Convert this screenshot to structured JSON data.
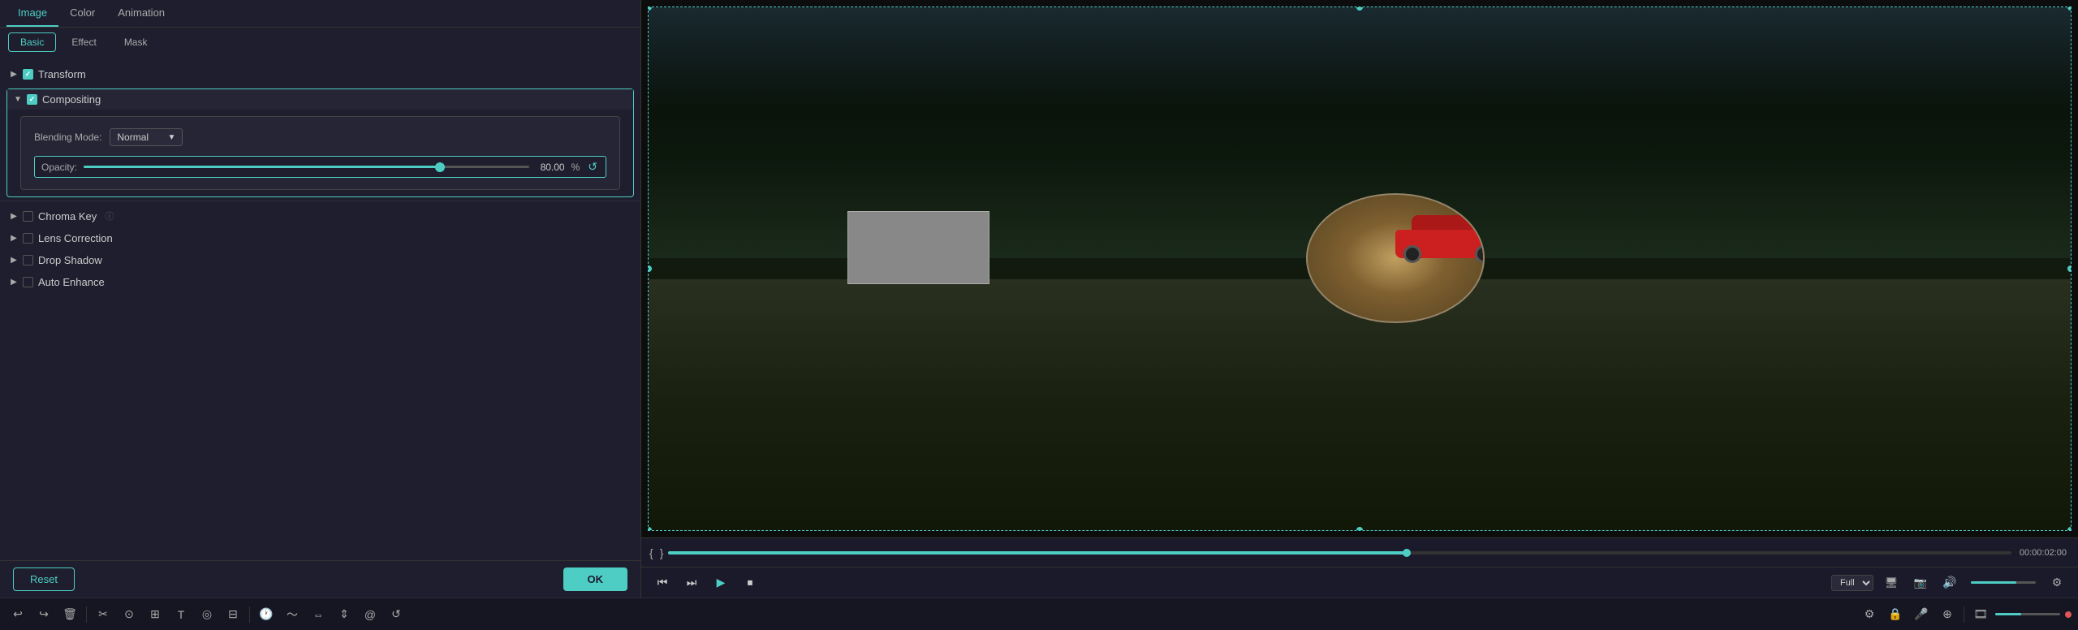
{
  "topTabs": [
    {
      "id": "image",
      "label": "Image",
      "active": true
    },
    {
      "id": "color",
      "label": "Color",
      "active": false
    },
    {
      "id": "animation",
      "label": "Animation",
      "active": false
    }
  ],
  "subTabs": [
    {
      "id": "basic",
      "label": "Basic",
      "active": true
    },
    {
      "id": "effect",
      "label": "Effect",
      "active": false
    },
    {
      "id": "mask",
      "label": "Mask",
      "active": false
    }
  ],
  "sections": {
    "transform": {
      "label": "Transform",
      "checked": true,
      "expanded": false
    },
    "compositing": {
      "label": "Compositing",
      "checked": true,
      "expanded": true,
      "blendModeLabel": "Blending Mode:",
      "blendModeValue": "Normal",
      "opacityLabel": "Opacity:",
      "opacityValue": "80.00",
      "opacityUnit": "%",
      "opacityPercent": 80
    },
    "chromaKey": {
      "label": "Chroma Key",
      "checked": false,
      "hasInfo": true
    },
    "lensCorrection": {
      "label": "Lens Correction",
      "checked": false
    },
    "dropShadow": {
      "label": "Drop Shadow",
      "checked": false
    },
    "autoEnhance": {
      "label": "Auto Enhance",
      "checked": false
    }
  },
  "buttons": {
    "reset": "Reset",
    "ok": "OK"
  },
  "timeline": {
    "timeDisplay": "00:00:02:00",
    "fullLabel": "Full"
  },
  "toolbar": {
    "leftTools": [
      "↩",
      "↪",
      "🗑",
      "✂",
      "⊙",
      "⊞",
      "T",
      "◎",
      "⊟",
      "↻",
      "↺",
      "⇔",
      "⇕",
      "◎",
      "↺"
    ],
    "rightTools": [
      "⚙",
      "🔒",
      "🎤",
      "⊕",
      "⊞",
      "─"
    ]
  }
}
